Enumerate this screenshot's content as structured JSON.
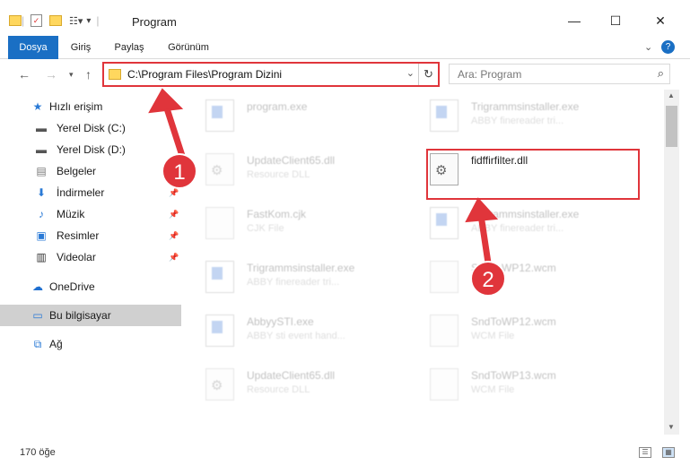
{
  "window": {
    "title": "Program"
  },
  "ribbon": {
    "tabs": [
      "Dosya",
      "Giriş",
      "Paylaş",
      "Görünüm"
    ]
  },
  "address": {
    "path": "C:\\Program Files\\Program Dizini"
  },
  "search": {
    "placeholder": "Ara: Program"
  },
  "sidebar": {
    "items": [
      {
        "label": "Hızlı erişim",
        "icon": "star-icon"
      },
      {
        "label": "Yerel Disk (C:)",
        "icon": "drive-icon"
      },
      {
        "label": "Yerel Disk (D:)",
        "icon": "drive-icon"
      },
      {
        "label": "Belgeler",
        "icon": "documents-icon"
      },
      {
        "label": "İndirmeler",
        "icon": "download-icon"
      },
      {
        "label": "Müzik",
        "icon": "music-icon"
      },
      {
        "label": "Resimler",
        "icon": "pictures-icon"
      },
      {
        "label": "Videolar",
        "icon": "video-icon"
      },
      {
        "label": "OneDrive",
        "icon": "cloud-icon"
      },
      {
        "label": "Bu bilgisayar",
        "icon": "computer-icon"
      },
      {
        "label": "Ağ",
        "icon": "network-icon"
      }
    ]
  },
  "files": [
    {
      "name": "program.exe",
      "sub": ""
    },
    {
      "name": "Trigrammsinstaller.exe",
      "sub": "ABBY finereader tri..."
    },
    {
      "name": "UpdateClient65.dll",
      "sub": "Resource DLL"
    },
    {
      "name": "fidffirfilter.dll",
      "sub": ""
    },
    {
      "name": "FastKom.cjk",
      "sub": "CJK File"
    },
    {
      "name": "Trigrammsinstaller.exe",
      "sub": "ABBY finereader tri..."
    },
    {
      "name": "Trigrammsinstaller.exe",
      "sub": "ABBY finereader tri..."
    },
    {
      "name": "SndToWP12.wcm",
      "sub": ""
    },
    {
      "name": "AbbyySTI.exe",
      "sub": "ABBY sti event hand..."
    },
    {
      "name": "SndToWP12.wcm",
      "sub": "WCM File"
    },
    {
      "name": "UpdateClient65.dll",
      "sub": "Resource DLL"
    },
    {
      "name": "SndToWP13.wcm",
      "sub": "WCM File"
    }
  ],
  "status": {
    "count": "170 öğe"
  },
  "annotations": [
    "1",
    "2"
  ],
  "colors": {
    "accent": "#1a6fc4",
    "highlight": "#e0353b"
  }
}
